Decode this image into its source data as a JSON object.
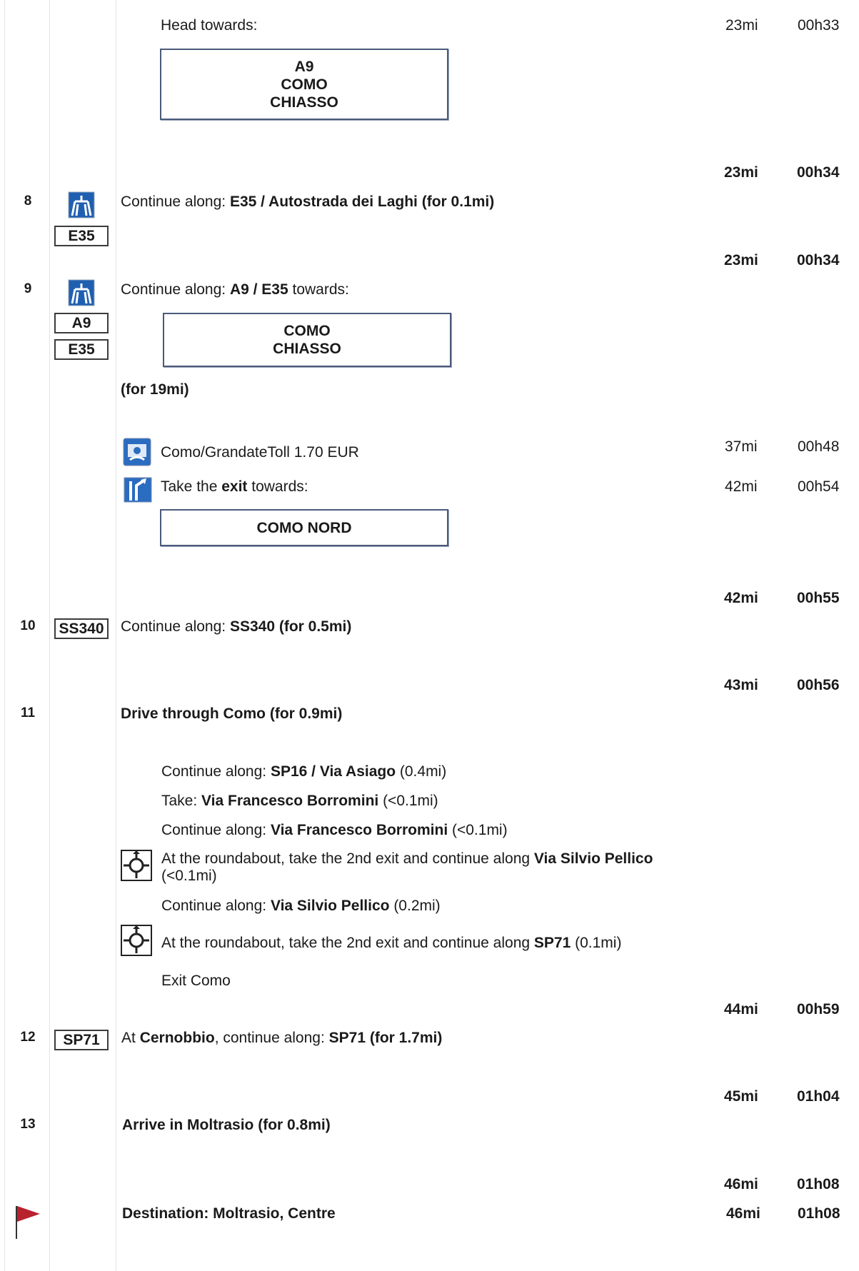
{
  "top": {
    "instruction": "Head towards:",
    "sign_lines": [
      "A9",
      "COMO",
      "CHIASSO"
    ],
    "distance": "23mi",
    "time": "00h33"
  },
  "steps": [
    {
      "number": "8",
      "distance": "23mi",
      "time": "00h34",
      "shields": [
        "E35"
      ],
      "prefix": "Continue along: ",
      "road": "E35 / Autostrada dei Laghi (for 0.1mi)"
    },
    {
      "number": "9",
      "distance": "23mi",
      "time": "00h34",
      "shields": [
        "A9",
        "E35"
      ],
      "prefix": "Continue along: ",
      "road": "A9 / E35",
      "suffix": " towards:",
      "sign_lines": [
        "COMO",
        "CHIASSO"
      ],
      "for_text": "(for 19mi)",
      "substeps": [
        {
          "text": "Como/GrandateToll 1.70 EUR",
          "icon": "toll-icon",
          "distance": "37mi",
          "time": "00h48"
        },
        {
          "prefix": "Take the ",
          "bold": "exit",
          "suffix": " towards:",
          "icon": "exit-icon",
          "distance": "42mi",
          "time": "00h54",
          "sign": "COMO NORD"
        }
      ]
    },
    {
      "number": "10",
      "distance": "42mi",
      "time": "00h55",
      "shields": [
        "SS340"
      ],
      "prefix": "Continue along: ",
      "road": "SS340 (for 0.5mi)"
    },
    {
      "number": "11",
      "distance": "43mi",
      "time": "00h56",
      "title": "Drive through Como (for 0.9mi)",
      "substeps": [
        {
          "prefix": "Continue along: ",
          "bold": "SP16 / Via Asiago",
          "suffix": " (0.4mi)"
        },
        {
          "prefix": "Take: ",
          "bold": "Via Francesco Borromini",
          "suffix": " (<0.1mi)"
        },
        {
          "prefix": "Continue along: ",
          "bold": "Via Francesco Borromini",
          "suffix": " (<0.1mi)"
        },
        {
          "prefix": "At the roundabout, take the 2nd exit and continue along ",
          "bold": "Via Silvio Pellico",
          "line2": "(<0.1mi)",
          "icon": "roundabout-icon"
        },
        {
          "prefix": "Continue along: ",
          "bold": "Via Silvio Pellico",
          "suffix": " (0.2mi)"
        },
        {
          "prefix": "At the roundabout, take the 2nd exit and continue along ",
          "bold": "SP71",
          "suffix": " (0.1mi)",
          "icon": "roundabout-icon"
        },
        {
          "text": "Exit Como"
        }
      ]
    },
    {
      "number": "12",
      "distance": "44mi",
      "time": "00h59",
      "shields": [
        "SP71"
      ],
      "prefix": "At ",
      "place": "Cernobbio",
      "middle": ", continue along: ",
      "road": "SP71 (for 1.7mi)"
    },
    {
      "number": "13",
      "distance": "45mi",
      "time": "01h04",
      "title": "Arrive in Moltrasio (for 0.8mi)"
    }
  ],
  "destination": {
    "distance_before": "46mi",
    "time_before": "01h08",
    "label": "Destination: Moltrasio, Centre",
    "distance": "46mi",
    "time": "01h08",
    "icon": "flag-icon"
  }
}
